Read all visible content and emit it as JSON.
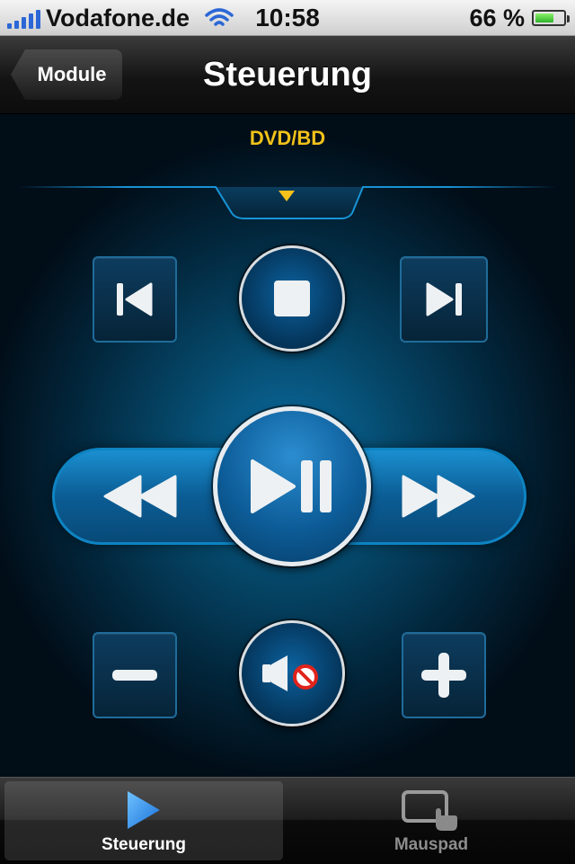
{
  "status_bar": {
    "carrier": "Vodafone.de",
    "time": "10:58",
    "battery_percent": "66 %",
    "battery_level": 0.66,
    "signal_bars": 5,
    "wifi": true
  },
  "nav": {
    "back_label": "Module",
    "title": "Steuerung"
  },
  "device": {
    "label": "DVD/BD"
  },
  "controls": {
    "previous": "skip-back-icon",
    "stop": "stop-icon",
    "next": "skip-forward-icon",
    "rewind": "rewind-icon",
    "play_pause": "play-pause-icon",
    "fast_forward": "fast-forward-icon",
    "volume_down": "minus-icon",
    "mute": "mute-icon",
    "volume_up": "plus-icon"
  },
  "tabs": [
    {
      "label": "Steuerung",
      "icon": "play-triangle-icon",
      "selected": true
    },
    {
      "label": "Mauspad",
      "icon": "touchpad-icon",
      "selected": false
    }
  ],
  "colors": {
    "accent_yellow": "#f2c21a",
    "remote_blue": "#0b6ea3",
    "signal_blue": "#2b67d6",
    "battery_green": "#3fc232"
  }
}
